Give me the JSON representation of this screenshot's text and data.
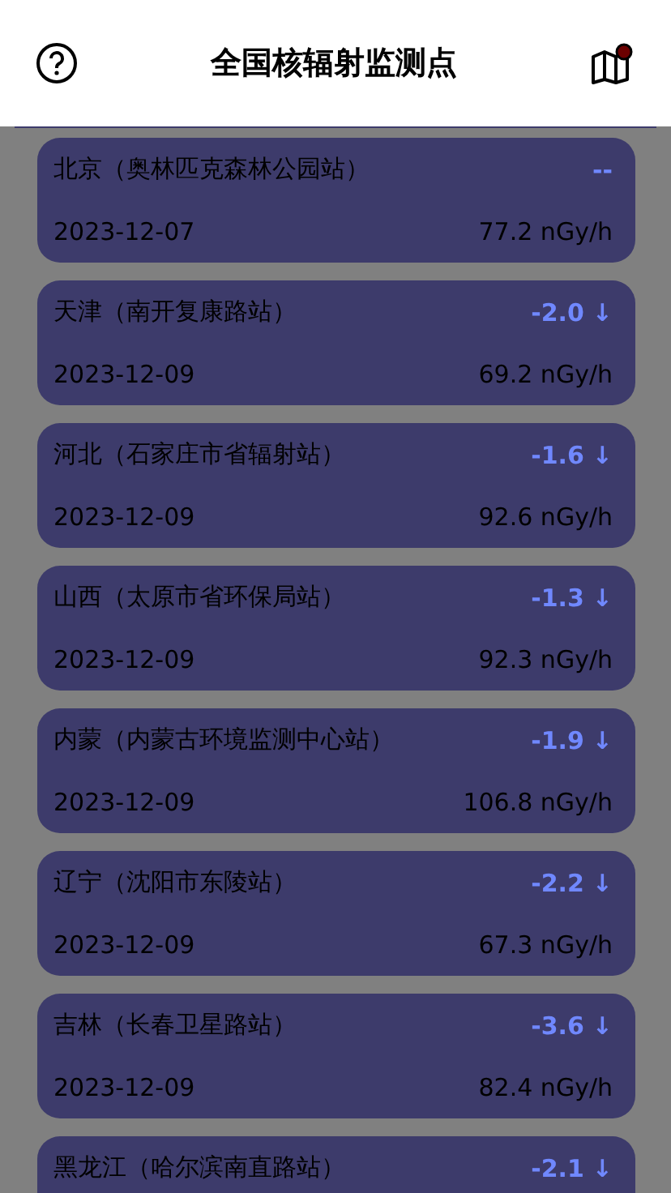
{
  "header": {
    "title": "全国核辐射监测点"
  },
  "stations": [
    {
      "name": "北京（奥林匹克森林公园站）",
      "change": "--",
      "date": "2023-12-07",
      "reading": "77.2 nGy/h"
    },
    {
      "name": "天津（南开复康路站）",
      "change": "-2.0",
      "arrow": "↓",
      "date": "2023-12-09",
      "reading": "69.2 nGy/h"
    },
    {
      "name": "河北（石家庄市省辐射站）",
      "change": "-1.6",
      "arrow": "↓",
      "date": "2023-12-09",
      "reading": "92.6 nGy/h"
    },
    {
      "name": "山西（太原市省环保局站）",
      "change": "-1.3",
      "arrow": "↓",
      "date": "2023-12-09",
      "reading": "92.3 nGy/h"
    },
    {
      "name": "内蒙（内蒙古环境监测中心站）",
      "change": "-1.9",
      "arrow": "↓",
      "date": "2023-12-09",
      "reading": "106.8 nGy/h"
    },
    {
      "name": "辽宁（沈阳市东陵站）",
      "change": "-2.2",
      "arrow": "↓",
      "date": "2023-12-09",
      "reading": "67.3 nGy/h"
    },
    {
      "name": "吉林（长春卫星路站）",
      "change": "-3.6",
      "arrow": "↓",
      "date": "2023-12-09",
      "reading": "82.4 nGy/h"
    },
    {
      "name": "黑龙江（哈尔滨南直路站）",
      "change": "-2.1",
      "arrow": "↓"
    }
  ]
}
